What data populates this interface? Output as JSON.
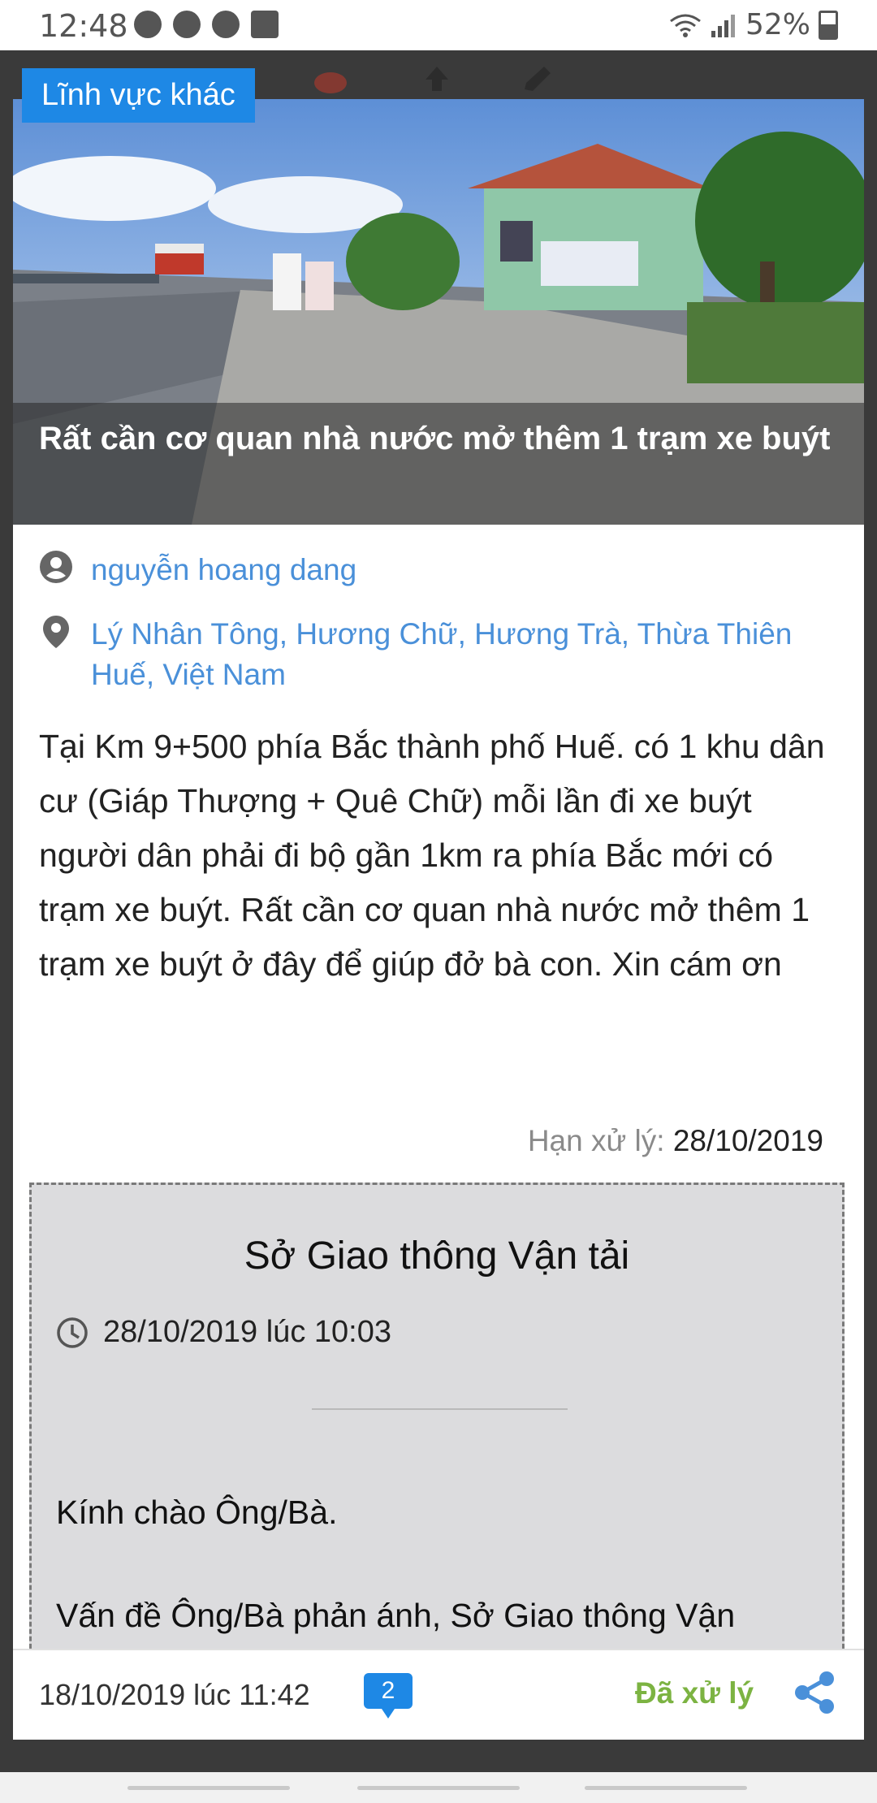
{
  "status_bar": {
    "time": "12:48",
    "battery": "52%"
  },
  "post": {
    "category": "Lĩnh vực khác",
    "title": "Rất cần cơ quan nhà nước mở thêm 1 trạm xe buýt",
    "author": "nguyễn hoang dang",
    "location": "Lý Nhân Tông, Hương Chữ, Hương Trà, Thừa Thiên Huế, Việt Nam",
    "body": "Tại Km 9+500 phía Bắc thành phố Huế. có 1 khu dân cư (Giáp Thượng + Quê Chữ) mỗi lần đi xe buýt người dân phải đi bộ gần 1km ra phía Bắc mới có trạm xe buýt. Rất cần cơ quan nhà nước mở thêm 1 trạm xe buýt ở đây để giúp đở bà con. Xin cám ơn",
    "deadline_label": "Hạn xử lý:",
    "deadline_value": "28/10/2019"
  },
  "reply": {
    "agency": "Sở Giao thông Vận tải",
    "time": "28/10/2019 lúc 10:03",
    "greeting": "Kính chào Ông/Bà.",
    "body": "Vấn đề Ông/Bà phản ánh, Sở Giao thông Vận"
  },
  "footer": {
    "date": "18/10/2019 lúc 11:42",
    "comment_count": "2",
    "status": "Đã xử lý"
  },
  "colors": {
    "accent": "#1e88e5",
    "link": "#4a90d9",
    "status_ok": "#7cb342",
    "reply_bg": "#dcdcde"
  }
}
